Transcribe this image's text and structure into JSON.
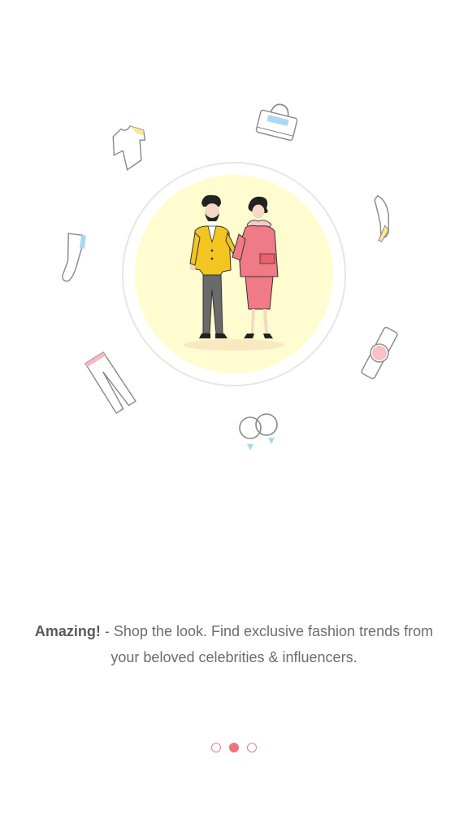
{
  "onboarding": {
    "caption_lead": "Amazing!",
    "caption_text": " - Shop the look. Find exclusive fashion trends from your beloved celebrities & influencers."
  },
  "pager": {
    "total": 3,
    "active_index": 1
  },
  "colors": {
    "accent": "#f07280",
    "circle_fill": "#fffccf",
    "text": "#6c6c6c"
  },
  "icons": [
    "tshirt-icon",
    "handbag-icon",
    "high-heel-icon",
    "sneaker-icon",
    "watch-icon",
    "trousers-icon",
    "earrings-icon"
  ]
}
